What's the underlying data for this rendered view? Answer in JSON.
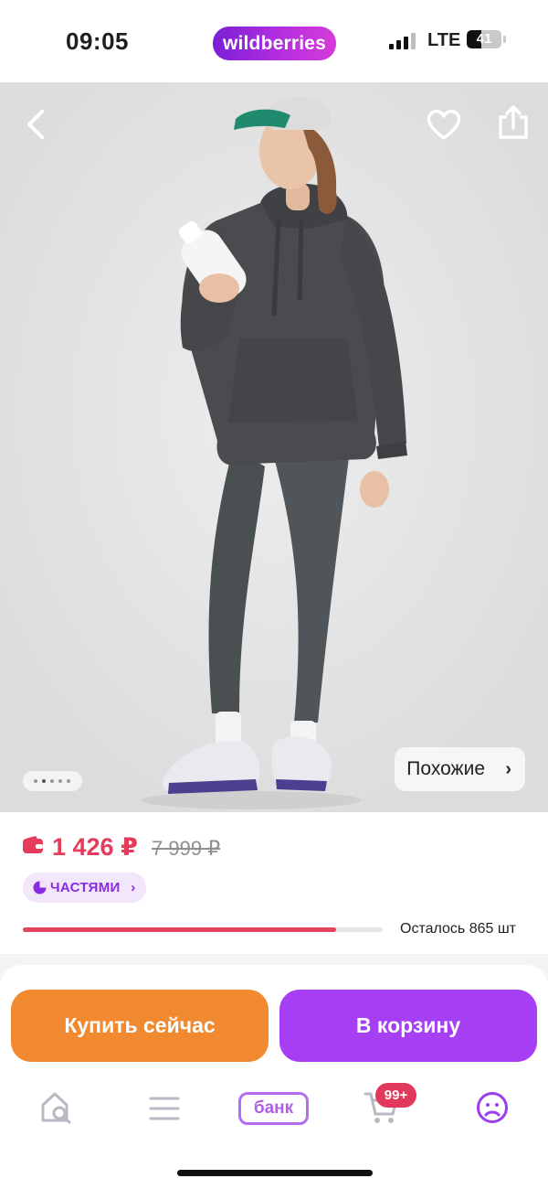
{
  "status_bar": {
    "time": "09:05",
    "brand": "wildberries",
    "network": "LTE",
    "battery_percent": "41"
  },
  "product_image": {
    "similar_label": "Похожие",
    "similar_chevron": "›",
    "image_page_count": 5,
    "image_page_active": 2,
    "icons": [
      "back-arrow-icon",
      "heart-icon",
      "share-icon"
    ]
  },
  "price": {
    "current": "1 426 ₽",
    "old": "7 999 ₽",
    "installments_label": "ЧАСТЯМИ",
    "installments_chevron": "›",
    "stock_text": "Осталось 865 шт",
    "stock_fill_fraction": 0.87
  },
  "actions": {
    "buy_now": "Купить сейчас",
    "add_to_cart": "В корзину"
  },
  "bottom_nav": {
    "items": [
      "home-search-icon",
      "catalog-menu-icon",
      "bank-icon",
      "cart-icon",
      "profile-icon"
    ],
    "bank_label": "банк",
    "cart_badge": "99+"
  },
  "colors": {
    "brand_gradient_start": "#7a1fd6",
    "brand_gradient_end": "#d63bd8",
    "price_red": "#e53c5b",
    "buy_now_orange": "#f0892f",
    "cart_purple": "#a63ef4",
    "installments_purple": "#8a2be2"
  }
}
